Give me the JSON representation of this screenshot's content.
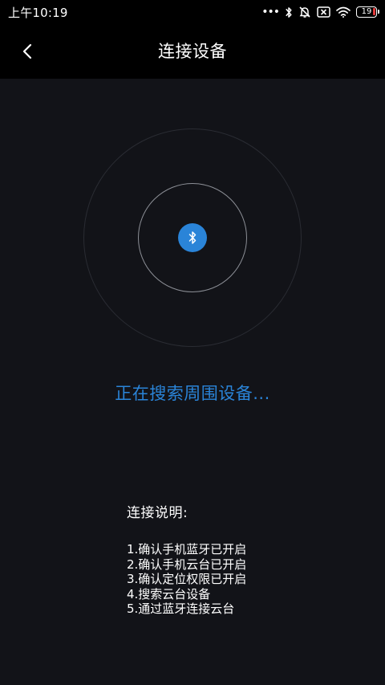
{
  "status_bar": {
    "time": "上午10:19",
    "battery_level": "19",
    "icons": [
      "more-dots-icon",
      "bluetooth-icon",
      "alarm-off-icon",
      "sim-x-icon",
      "wifi-icon",
      "battery-icon"
    ]
  },
  "header": {
    "back_icon": "chevron-left-icon",
    "title": "连接设备"
  },
  "scanner": {
    "center_icon": "bluetooth-icon",
    "accent_color": "#2a84d8"
  },
  "search_status": "正在搜索周围设备...",
  "instructions": {
    "title": "连接说明:",
    "items": [
      "1.确认手机蓝牙已开启",
      "2.确认手机云台已开启",
      "3.确认定位权限已开启",
      "4.搜索云台设备",
      "5.通过蓝牙连接云台"
    ]
  },
  "colors": {
    "background": "#121318",
    "header_background": "#000000",
    "accent": "#2a84d8",
    "battery_low": "#e23a3a"
  }
}
